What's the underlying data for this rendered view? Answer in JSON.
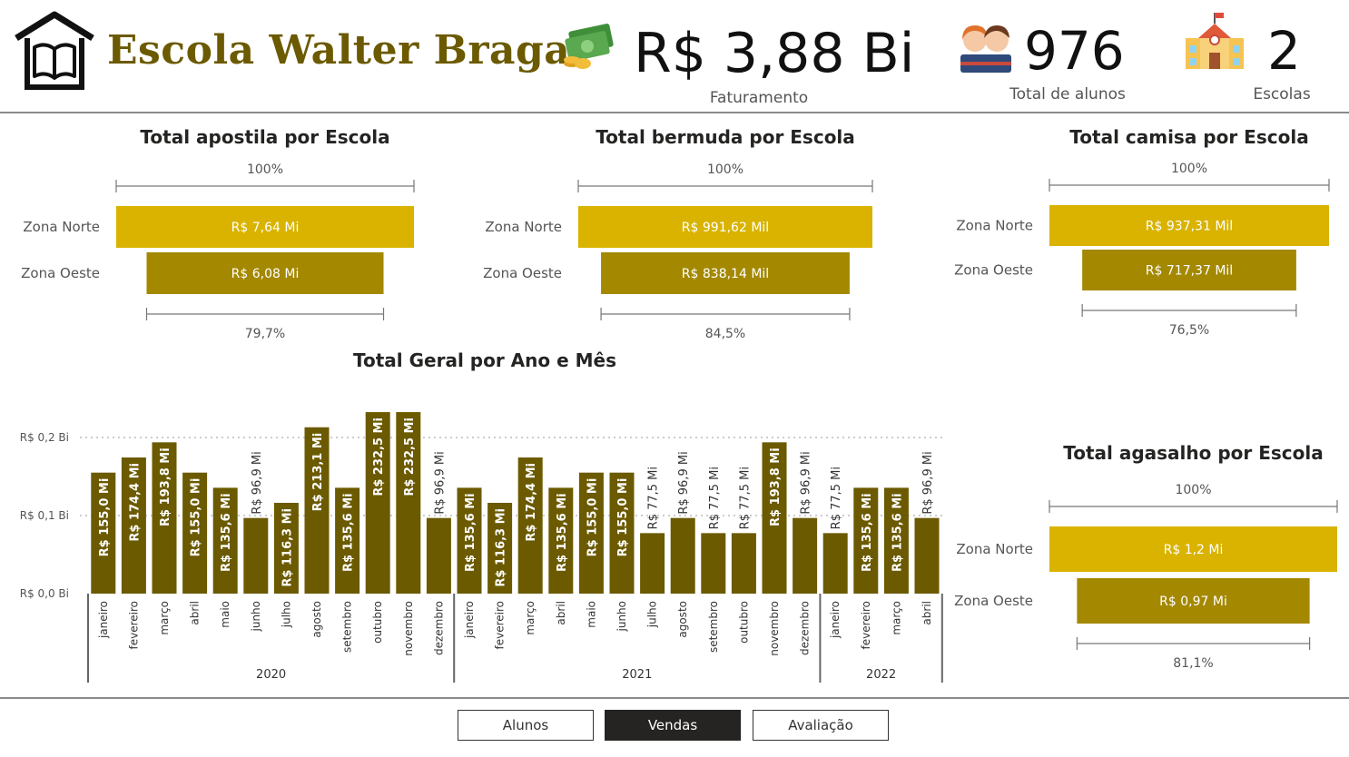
{
  "header": {
    "title": "Escola Walter Braga",
    "kpis": [
      {
        "value": "R$ 3,88 Bi",
        "label": "Faturamento",
        "icon": "money-icon"
      },
      {
        "value": "976",
        "label": "Total de alunos",
        "icon": "students-icon"
      },
      {
        "value": "2",
        "label": "Escolas",
        "icon": "school-icon"
      }
    ]
  },
  "colors": {
    "norte": "#D9B300",
    "oeste": "#A38800",
    "bar": "#6B5A00",
    "title": "#6B5A00"
  },
  "funnels": [
    {
      "id": "apostila",
      "title": "Total apostila por Escola",
      "top_pct": "100%",
      "bottom_pct": "79,7%",
      "rows": [
        {
          "label": "Zona Norte",
          "value": 7.64,
          "text": "R$ 7,64 Mi"
        },
        {
          "label": "Zona Oeste",
          "value": 6.08,
          "text": "R$ 6,08 Mi"
        }
      ]
    },
    {
      "id": "bermuda",
      "title": "Total bermuda por Escola",
      "top_pct": "100%",
      "bottom_pct": "84,5%",
      "rows": [
        {
          "label": "Zona Norte",
          "value": 991.62,
          "text": "R$ 991,62 Mil"
        },
        {
          "label": "Zona Oeste",
          "value": 838.14,
          "text": "R$ 838,14 Mil"
        }
      ]
    },
    {
      "id": "camisa",
      "title": "Total camisa por Escola",
      "top_pct": "100%",
      "bottom_pct": "76,5%",
      "rows": [
        {
          "label": "Zona Norte",
          "value": 937.31,
          "text": "R$ 937,31 Mil"
        },
        {
          "label": "Zona Oeste",
          "value": 717.37,
          "text": "R$ 717,37 Mil"
        }
      ]
    },
    {
      "id": "agasalho",
      "title": "Total agasalho por Escola",
      "top_pct": "100%",
      "bottom_pct": "81,1%",
      "rows": [
        {
          "label": "Zona Norte",
          "value": 1.2,
          "text": "R$ 1,2 Mi"
        },
        {
          "label": "Zona Oeste",
          "value": 0.97,
          "text": "R$ 0,97 Mi"
        }
      ]
    }
  ],
  "chart_data": {
    "type": "bar",
    "title": "Total Geral por Ano e Mês",
    "ylim": [
      0,
      0.2
    ],
    "yticks": [
      {
        "value": 0.0,
        "label": "R$ 0,0 Bi"
      },
      {
        "value": 0.1,
        "label": "R$ 0,1 Bi"
      },
      {
        "value": 0.2,
        "label": "R$ 0,2 Bi"
      }
    ],
    "grid": true,
    "groups": [
      {
        "year": "2020",
        "categories": [
          "janeiro",
          "fevereiro",
          "março",
          "abril",
          "maio",
          "junho",
          "julho",
          "agosto",
          "setembro",
          "outubro",
          "novembro",
          "dezembro"
        ],
        "values": [
          155.0,
          174.4,
          193.8,
          155.0,
          135.6,
          96.9,
          116.3,
          213.1,
          135.6,
          232.5,
          232.5,
          96.9
        ],
        "labels": [
          "R$ 155,0 Mi",
          "R$ 174,4 Mi",
          "R$ 193,8 Mi",
          "R$ 155,0 Mi",
          "R$ 135,6 Mi",
          "R$ 96,9 Mi",
          "R$ 116,3 Mi",
          "R$ 213,1 Mi",
          "R$ 135,6 Mi",
          "R$ 232,5 Mi",
          "R$ 232,5 Mi",
          "R$ 96,9 Mi"
        ]
      },
      {
        "year": "2021",
        "categories": [
          "janeiro",
          "fevereiro",
          "março",
          "abril",
          "maio",
          "junho",
          "julho",
          "agosto",
          "setembro",
          "outubro",
          "novembro",
          "dezembro"
        ],
        "values": [
          135.6,
          116.3,
          174.4,
          135.6,
          155.0,
          155.0,
          77.5,
          96.9,
          77.5,
          77.5,
          193.8,
          96.9
        ],
        "labels": [
          "R$ 135,6 Mi",
          "R$ 116,3 Mi",
          "R$ 174,4 Mi",
          "R$ 135,6 Mi",
          "R$ 155,0 Mi",
          "R$ 155,0 Mi",
          "R$ 77,5 Mi",
          "R$ 96,9 Mi",
          "R$ 77,5 Mi",
          "R$ 77,5 Mi",
          "R$ 193,8 Mi",
          "R$ 96,9 Mi"
        ]
      },
      {
        "year": "2022",
        "categories": [
          "janeiro",
          "fevereiro",
          "março",
          "abril"
        ],
        "values": [
          77.5,
          135.6,
          135.6,
          96.9
        ],
        "labels": [
          "R$ 77,5 Mi",
          "R$ 135,6 Mi",
          "R$ 135,6 Mi",
          "R$ 96,9 Mi"
        ]
      }
    ]
  },
  "nav": [
    {
      "label": "Alunos",
      "active": false
    },
    {
      "label": "Vendas",
      "active": true
    },
    {
      "label": "Avaliação",
      "active": false
    }
  ]
}
